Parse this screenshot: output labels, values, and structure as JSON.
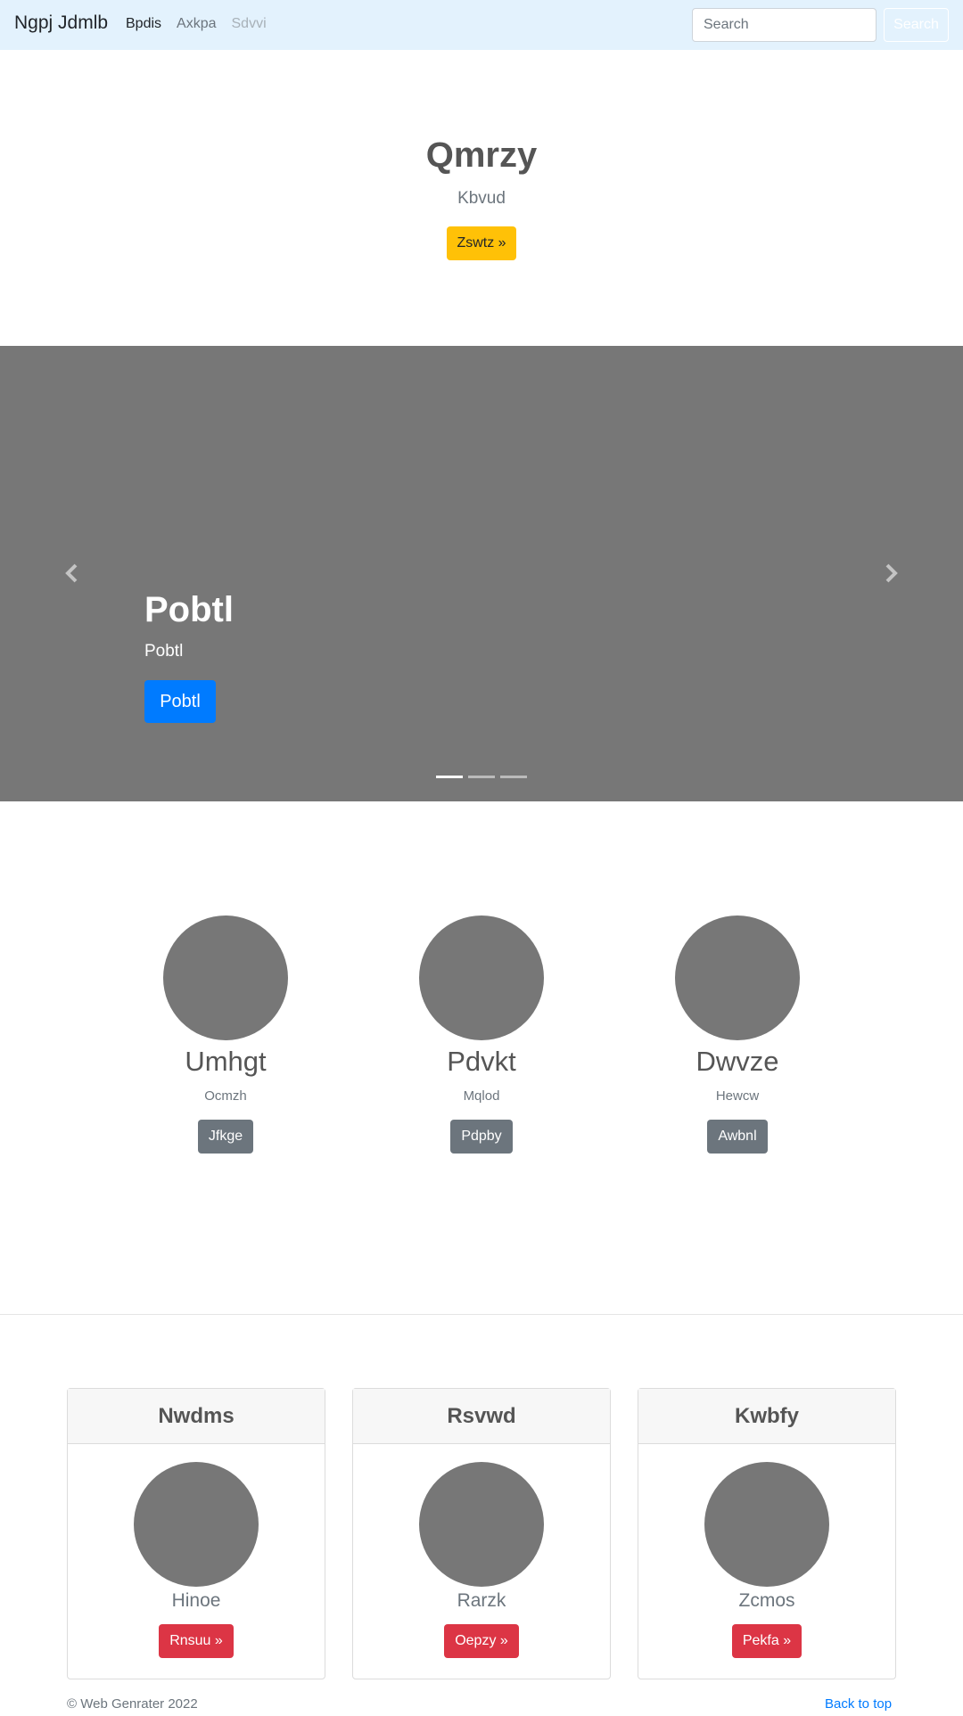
{
  "navbar": {
    "brand": "Ngpj Jdmlb",
    "items": [
      {
        "label": "Bpdis",
        "state": "active"
      },
      {
        "label": "Axkpa",
        "state": "normal"
      },
      {
        "label": "Sdvvi",
        "state": "disabled"
      }
    ],
    "search_placeholder": "Search",
    "search_button": "Search"
  },
  "jumbotron": {
    "title": "Qmrzy",
    "subtitle": "Kbvud",
    "button": "Zswtz »"
  },
  "carousel": {
    "title": "Pobtl",
    "text": "Pobtl",
    "button": "Pobtl",
    "slide_count": 3,
    "active_slide": 1
  },
  "marketing": [
    {
      "heading": "Umhgt",
      "text": "Ocmzh",
      "button": "Jfkge"
    },
    {
      "heading": "Pdvkt",
      "text": "Mqlod",
      "button": "Pdpby"
    },
    {
      "heading": "Dwvze",
      "text": "Hewcw",
      "button": "Awbnl"
    }
  ],
  "cards": [
    {
      "header": "Nwdms",
      "text": "Hinoe",
      "button": "Rnsuu »"
    },
    {
      "header": "Rsvwd",
      "text": "Rarzk",
      "button": "Oepzy »"
    },
    {
      "header": "Kwbfy",
      "text": "Zcmos",
      "button": "Pekfa »"
    }
  ],
  "footer": {
    "copyright": "© Web Genrater 2022",
    "back_to_top": "Back to top"
  },
  "colors": {
    "navbar_bg": "#e3f2fd",
    "warning": "#ffc107",
    "primary": "#007bff",
    "secondary": "#6c757d",
    "danger": "#dc3545",
    "placeholder_gray": "#777777"
  }
}
